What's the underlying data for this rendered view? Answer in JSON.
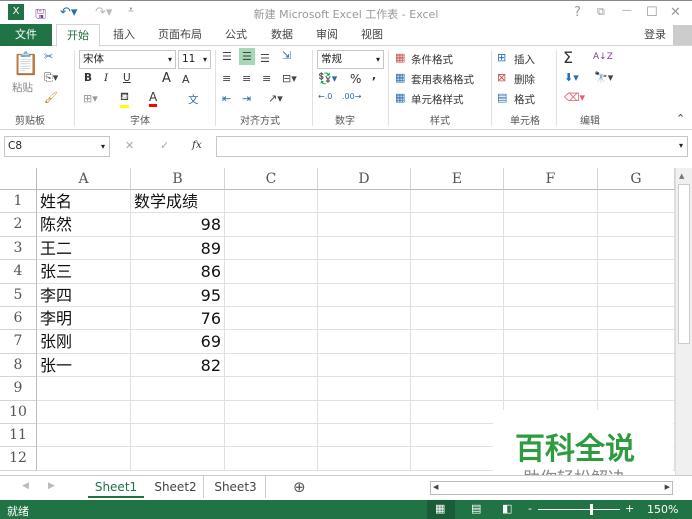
{
  "title_bar": {
    "title": "新建 Microsoft Excel 工作表 - Excel",
    "help": "?",
    "restore_ribbon": "⧉",
    "minimize": "—",
    "maximize": "☐",
    "close": "✕"
  },
  "tabs": [
    {
      "label": "文件"
    },
    {
      "label": "开始"
    },
    {
      "label": "插入"
    },
    {
      "label": "页面布局"
    },
    {
      "label": "公式"
    },
    {
      "label": "数据"
    },
    {
      "label": "审阅"
    },
    {
      "label": "视图"
    }
  ],
  "signin": "登录",
  "ribbon": {
    "clipboard": {
      "label": "剪贴板",
      "paste": "粘贴"
    },
    "font": {
      "label": "字体",
      "name": "宋体",
      "size": "11",
      "bold": "B",
      "italic": "I",
      "underline": "U",
      "grow": "A",
      "shrink": "A",
      "font_color": "A",
      "phonetic": "文",
      "highlight_color": "#ffff00",
      "font_color_hex": "#ff0000"
    },
    "alignment": {
      "label": "对齐方式"
    },
    "number": {
      "label": "数字",
      "format": "常规",
      "percent": "%",
      "comma": ","
    },
    "styles": {
      "label": "样式",
      "conditional": "条件格式",
      "table": "套用表格格式",
      "cell_styles": "单元格样式"
    },
    "cells": {
      "label": "单元格",
      "insert": "插入",
      "delete": "删除",
      "format": "格式"
    },
    "editing": {
      "label": "编辑",
      "sum": "Σ",
      "sort": "A↓Z"
    }
  },
  "formula_bar": {
    "name_box": "C8",
    "fx": "fx",
    "formula": ""
  },
  "columns": [
    "A",
    "B",
    "C",
    "D",
    "E",
    "F",
    "G"
  ],
  "rows": [
    "1",
    "2",
    "3",
    "4",
    "5",
    "6",
    "7",
    "8",
    "9",
    "10",
    "11",
    "12"
  ],
  "cells": [
    [
      "姓名",
      "数学成绩"
    ],
    [
      "陈然",
      "98"
    ],
    [
      "王二",
      "89"
    ],
    [
      "张三",
      "86"
    ],
    [
      "李四",
      "95"
    ],
    [
      "李明",
      "76"
    ],
    [
      "张刚",
      "69"
    ],
    [
      "张一",
      "82"
    ]
  ],
  "sheets": [
    {
      "label": "Sheet1",
      "active": true
    },
    {
      "label": "Sheet2"
    },
    {
      "label": "Sheet3"
    }
  ],
  "status": {
    "text": "就绪",
    "zoom": "150%",
    "zoom_level": 150
  },
  "watermark": {
    "title": "百科全说",
    "subtitle": "助你轻松解决"
  },
  "colors": {
    "accent": "#217346"
  }
}
